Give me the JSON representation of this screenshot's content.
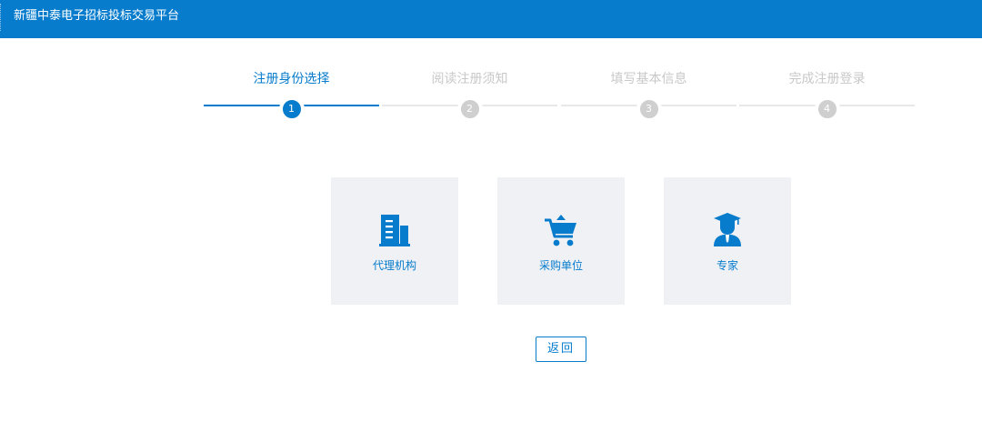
{
  "header": {
    "title": "新疆中泰电子招标投标交易平台",
    "background_color": "#077ccd"
  },
  "steps": [
    {
      "label": "注册身份选择",
      "number": "1",
      "active": true
    },
    {
      "label": "阅读注册须知",
      "number": "2",
      "active": false
    },
    {
      "label": "填写基本信息",
      "number": "3",
      "active": false
    },
    {
      "label": "完成注册登录",
      "number": "4",
      "active": false
    }
  ],
  "roles": [
    {
      "label": "代理机构",
      "icon": "building-icon"
    },
    {
      "label": "采购单位",
      "icon": "shopping-cart-icon"
    },
    {
      "label": "专家",
      "icon": "graduate-icon"
    }
  ],
  "actions": {
    "back_label": "返回"
  },
  "colors": {
    "accent": "#077ccd",
    "inactive": "#cfcfcf",
    "card_background": "#eff1f4"
  }
}
